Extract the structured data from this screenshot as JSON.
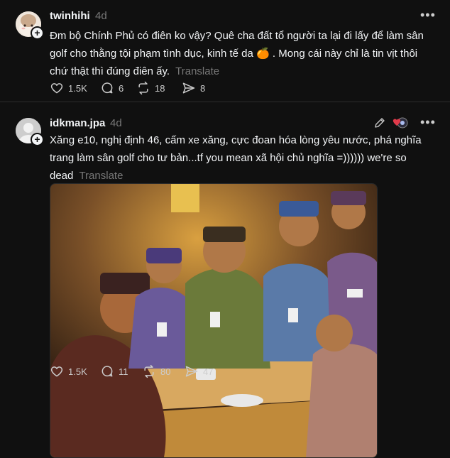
{
  "post1": {
    "username": "twinhihi",
    "time": "4d",
    "text_line1": "Đm bộ Chính Phủ có điên ko vậy? Quê cha đất tổ người ta lại đi lấy để làm sân",
    "text_line2": "golf cho thằng tội phạm tình dục, kinh tế da 🍊 . Mong cái này chỉ là tin vịt thôi",
    "text_line3": "chứ thật thì đúng điên ấy.",
    "translate": "Translate",
    "likes": "1.5K",
    "replies": "6",
    "reposts": "18",
    "shares": "8"
  },
  "post2": {
    "username": "idkman.jpa",
    "time": "4d",
    "text_line1": "Xăng e10, nghị định 46, cấm xe xăng, cực đoan hóa lòng yêu nước, phá nghĩa",
    "text_line2": "trang làm sân golf cho tư bản...tf you mean xã hội chủ nghĩa =)))))) we're so",
    "text_line3": "dead",
    "translate": "Translate",
    "likes": "1.5K",
    "replies": "11",
    "reposts": "80",
    "shares": "47"
  },
  "icons": [
    "heart-icon",
    "comment-icon",
    "repost-icon",
    "share-icon",
    "more-icon",
    "edit-icon",
    "plus-icon"
  ],
  "colors": {
    "background": "#101010",
    "text": "#f3f5f7",
    "muted": "#777777"
  }
}
